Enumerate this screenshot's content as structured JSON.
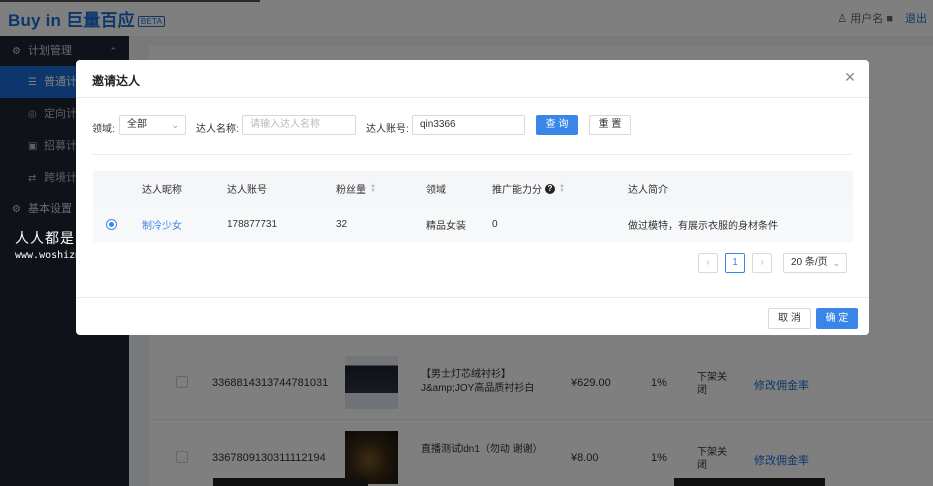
{
  "app": {
    "brand": "Buy in 巨量百应",
    "brand_tag": "BETA",
    "user": "用户名",
    "logout": "退出"
  },
  "sidebar": {
    "groups": [
      {
        "label": "计划管理"
      },
      {
        "label": "基本设置"
      }
    ],
    "items": [
      {
        "label": "普通计划",
        "icon": "list-icon",
        "active": true
      },
      {
        "label": "定向计划",
        "icon": "target-icon",
        "active": false
      },
      {
        "label": "招募计划",
        "icon": "recruit-icon",
        "active": false
      },
      {
        "label": "跨境计划",
        "icon": "cross-icon",
        "active": false
      }
    ]
  },
  "background_table": {
    "rows": [
      {
        "id": "3368814313744781031",
        "name": "【男士灯芯绒衬衫】J&amp;JOY高品质衬衫白",
        "price": "¥629.00",
        "rate": "1%",
        "status": "下架关闭",
        "action": "修改佣金率"
      },
      {
        "id": "3367809130311112194",
        "name": "直播测试ldn1（勿动 谢谢）",
        "price": "¥8.00",
        "rate": "1%",
        "status": "下架关闭",
        "action": "修改佣金率"
      }
    ]
  },
  "watermark": {
    "line1": "人人都是自媒体",
    "line2": "www.woshizmt.cn"
  },
  "modal": {
    "title": "邀请达人",
    "filters": {
      "domain_label": "领域:",
      "domain_value": "全部",
      "name_label": "达人名称:",
      "name_placeholder": "请输入达人名称",
      "account_label": "达人账号:",
      "account_value": "qin3366",
      "query_button": "查 询",
      "reset_button": "重 置"
    },
    "table": {
      "headers": {
        "nickname": "达人昵称",
        "account": "达人账号",
        "fans": "粉丝量",
        "domain": "领域",
        "power": "推广能力分",
        "intro": "达人简介"
      },
      "rows": [
        {
          "nickname": "制冷少女",
          "account": "178877731",
          "fans": "32",
          "domain": "精品女装",
          "power": "0",
          "intro": "做过模特，有展示衣服的身材条件",
          "selected": true
        }
      ]
    },
    "pagination": {
      "prev": "‹",
      "current": "1",
      "next": "›",
      "page_size": "20 条/页"
    },
    "footer": {
      "cancel": "取 消",
      "ok": "确 定"
    }
  },
  "colors": {
    "primary": "#3a86e8",
    "sidebar_bg": "#1f2430",
    "overlay": "rgba(0,0,0,0.5)"
  }
}
